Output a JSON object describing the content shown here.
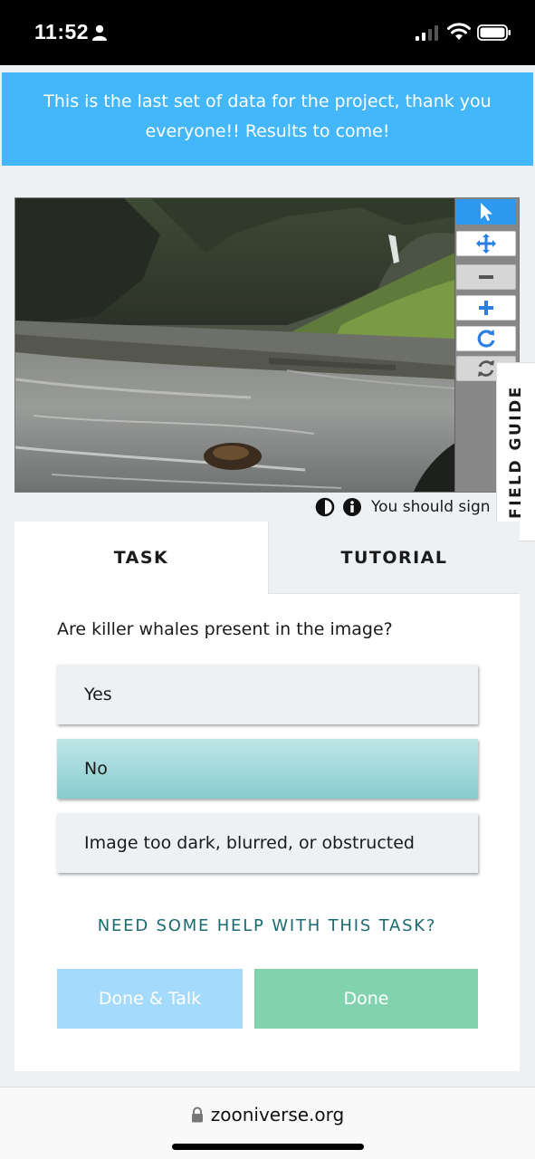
{
  "status_bar": {
    "time": "11:52",
    "icons": [
      "person-icon",
      "signal-icon",
      "wifi-icon",
      "battery-icon"
    ]
  },
  "banner": {
    "text": "This is the last set of data for the project, thank you everyone!! Results to come!"
  },
  "viewer": {
    "tools": [
      "pointer-icon",
      "move-icon",
      "zoom-out-icon",
      "zoom-in-icon",
      "rotate-icon",
      "reset-icon"
    ],
    "active_tool": "pointer-icon"
  },
  "field_guide": {
    "label": "FIELD GUIDE"
  },
  "meta": {
    "icons": [
      "contrast-icon",
      "info-icon"
    ],
    "sign_in_text": "You should sign"
  },
  "tabs": [
    {
      "label": "TASK",
      "active": true
    },
    {
      "label": "TUTORIAL",
      "active": false
    }
  ],
  "task": {
    "question": "Are killer whales present in the image?",
    "answers": [
      {
        "label": "Yes",
        "selected": false
      },
      {
        "label": "No",
        "selected": true
      },
      {
        "label": "Image too dark, blurred, or obstructed",
        "selected": false
      }
    ],
    "help_link": "NEED SOME HELP WITH THIS TASK?",
    "done_talk_label": "Done & Talk",
    "done_label": "Done"
  },
  "url_bar": {
    "url": "zooniverse.org"
  },
  "colors": {
    "banner": "#43b7fa",
    "active_tool": "#2c98f0",
    "help_link": "#1b6a6f",
    "done_talk": "#a4dafc",
    "done": "#82d3ad",
    "selected_answer": "#86cccf"
  }
}
